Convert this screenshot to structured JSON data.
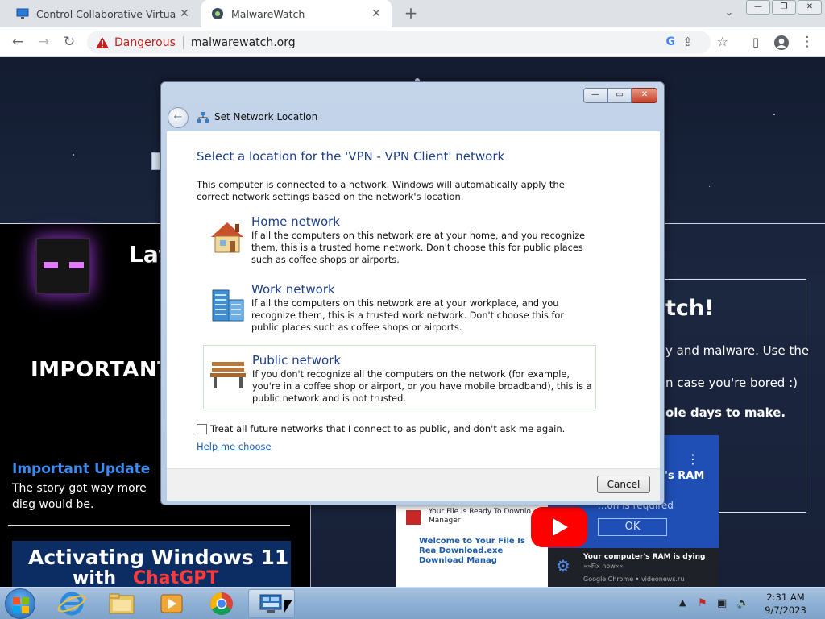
{
  "browser": {
    "tabs": [
      {
        "title": "Control Collaborative Virtual Ma",
        "icon": "monitor-icon"
      },
      {
        "title": "MalwareWatch",
        "icon": "malwarewatch-favicon"
      }
    ],
    "new_tab": "+",
    "tab_search": "⌄",
    "window_controls": [
      "—",
      "❐",
      "✕"
    ],
    "security_label": "Dangerous",
    "url": "malwarewatch.org",
    "google_badge": "G"
  },
  "webpage": {
    "latest_heading": "Lat",
    "important_heading": "IMPORTANT",
    "update_title": "Important Update",
    "update_text": "The story got way more disg would be.",
    "right_heading": "tch!",
    "right_line1": "y and malware. Use the",
    "right_line2": "n case you're bored :)",
    "right_line3": "ole days to make.",
    "video_title_line1": "Activating Windows 11",
    "video_title_line2": "with",
    "video_title_line3": "ChatGPT",
    "popup_header": "Your File Is Ready To Downlo Manager",
    "popup_body": "Welcome to Your File Is Rea Download.exe Download Manag",
    "ram_title": "'s RAM",
    "ram_required": "...on is required",
    "ram_ok": "OK",
    "ram_notify_title": "Your computer's RAM is dying",
    "ram_notify_sub": "»»Fix now««",
    "ram_notify_source": "Google Chrome • videonews.ru"
  },
  "dialog": {
    "title": "Set Network Location",
    "window_controls": [
      "—",
      "▭",
      "✕"
    ],
    "heading": "Select a location for the 'VPN - VPN Client' network",
    "intro": "This computer is connected to a network. Windows will automatically apply the correct network settings based on the network's location.",
    "options": [
      {
        "label": "Home network",
        "icon": "home-network-icon",
        "description": "If all the computers on this network are at your home, and you recognize them, this is a trusted home network.  Don't choose this for public places such as coffee shops or airports."
      },
      {
        "label": "Work network",
        "icon": "work-network-icon",
        "description": "If all the computers on this network are at your workplace, and you recognize them, this is a trusted work network.  Don't choose this for public places such as coffee shops or airports."
      },
      {
        "label": "Public network",
        "icon": "public-network-icon",
        "description": "If you don't recognize all the computers on the network (for example, you're in a coffee shop or airport, or you have mobile broadband), this is a public network and is not trusted."
      }
    ],
    "checkbox_label": "Treat all future networks that I connect to as public, and don't ask me again.",
    "checkbox_checked": false,
    "help_link": "Help me choose",
    "cancel_label": "Cancel"
  },
  "taskbar": {
    "pinned": [
      "internet-explorer-icon",
      "file-explorer-icon",
      "media-player-icon",
      "chrome-icon",
      "network-control-panel-icon"
    ],
    "active": "network-control-panel-icon",
    "tray_arrow": "▲",
    "time": "2:31 AM",
    "date": "9/7/2023"
  },
  "colors": {
    "chrome_tabstrip": "#dee1e6",
    "danger_red": "#c5221f",
    "dialog_heading_blue": "#1e3f8a",
    "link_blue": "#1f5fb5",
    "taskbar_blue": "#8eb0d4"
  }
}
